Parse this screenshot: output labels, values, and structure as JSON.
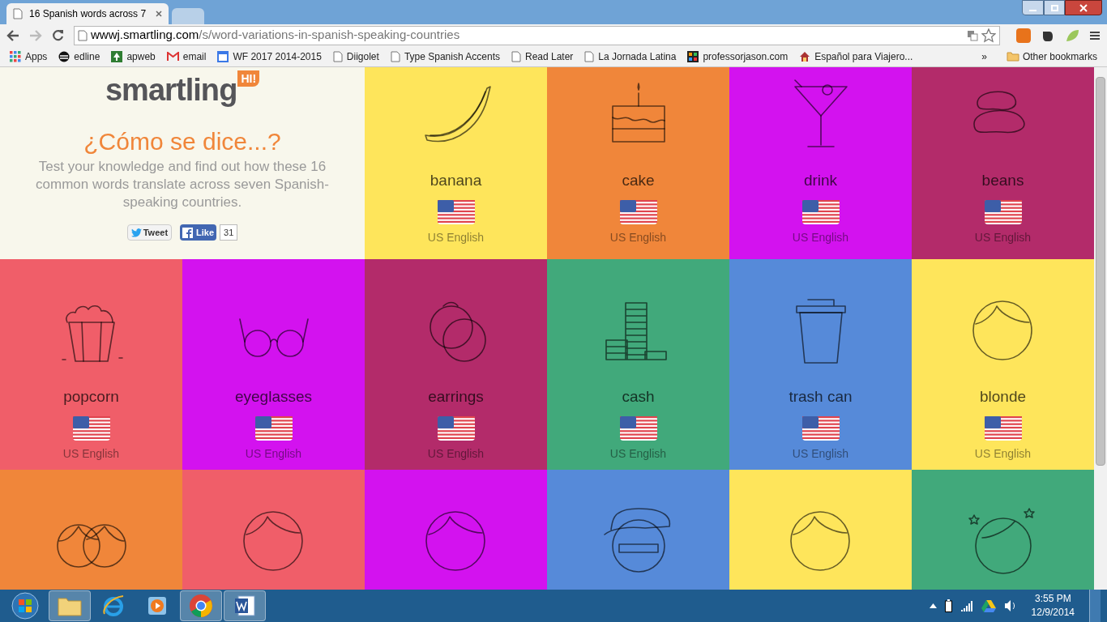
{
  "browser": {
    "tab": {
      "title": "16 Spanish words across 7"
    },
    "url": {
      "host": "wwwj.smartling.com",
      "path": "/s/word-variations-in-spanish-speaking-countries"
    },
    "bookmarks": [
      {
        "label": "Apps",
        "kind": "apps"
      },
      {
        "label": "edline",
        "kind": "swirl"
      },
      {
        "label": "apweb",
        "kind": "tree"
      },
      {
        "label": "email",
        "kind": "mail"
      },
      {
        "label": "WF 2017 2014-2015",
        "kind": "calendar"
      },
      {
        "label": "Diigolet",
        "kind": "page"
      },
      {
        "label": "Type Spanish Accents",
        "kind": "page"
      },
      {
        "label": "Read Later",
        "kind": "page"
      },
      {
        "label": "La Jornada Latina",
        "kind": "page"
      },
      {
        "label": "professorjason.com",
        "kind": "squares"
      },
      {
        "label": "Español para Viajero...",
        "kind": "house"
      }
    ],
    "overflow": "»",
    "other_bookmarks": "Other bookmarks"
  },
  "header": {
    "logo": "smartling",
    "logo_badge": "HI!",
    "title": "¿Cómo se dice...?",
    "description": "Test your knowledge and find out how these 16 common words translate across seven Spanish-speaking countries.",
    "tweet": "Tweet",
    "like": "Like",
    "like_count": "31"
  },
  "tiles": [
    {
      "word": "banana",
      "language": "US English",
      "color": "#fee55b",
      "kind": "banana"
    },
    {
      "word": "cake",
      "language": "US English",
      "color": "#f0863a",
      "kind": "cake"
    },
    {
      "word": "drink",
      "language": "US English",
      "color": "#d312ef",
      "kind": "drink"
    },
    {
      "word": "beans",
      "language": "US English",
      "color": "#b32b6a",
      "kind": "beans"
    },
    {
      "word": "popcorn",
      "language": "US English",
      "color": "#f05e69",
      "kind": "popcorn"
    },
    {
      "word": "eyeglasses",
      "language": "US English",
      "color": "#d312ef",
      "kind": "glasses"
    },
    {
      "word": "earrings",
      "language": "US English",
      "color": "#b32b6a",
      "kind": "earrings"
    },
    {
      "word": "cash",
      "language": "US English",
      "color": "#41a97b",
      "kind": "cash"
    },
    {
      "word": "trash can",
      "language": "US English",
      "color": "#568ad9",
      "kind": "trash"
    },
    {
      "word": "blonde",
      "language": "US English",
      "color": "#fee55b",
      "kind": "face"
    },
    {
      "color": "#f0863a",
      "kind": "twins"
    },
    {
      "color": "#f05e69",
      "kind": "face"
    },
    {
      "color": "#d312ef",
      "kind": "face"
    },
    {
      "color": "#568ad9",
      "kind": "cap"
    },
    {
      "color": "#fee55b",
      "kind": "face"
    },
    {
      "color": "#41a97b",
      "kind": "stars"
    }
  ],
  "taskbar": {
    "apps": [
      {
        "kind": "start"
      },
      {
        "kind": "folder",
        "selected": true
      },
      {
        "kind": "globe",
        "selected": false
      },
      {
        "kind": "play",
        "selected": false
      },
      {
        "kind": "chrome",
        "selected": true
      },
      {
        "kind": "document",
        "selected": true
      }
    ],
    "time": "3:55 PM",
    "date": "12/9/2014"
  }
}
